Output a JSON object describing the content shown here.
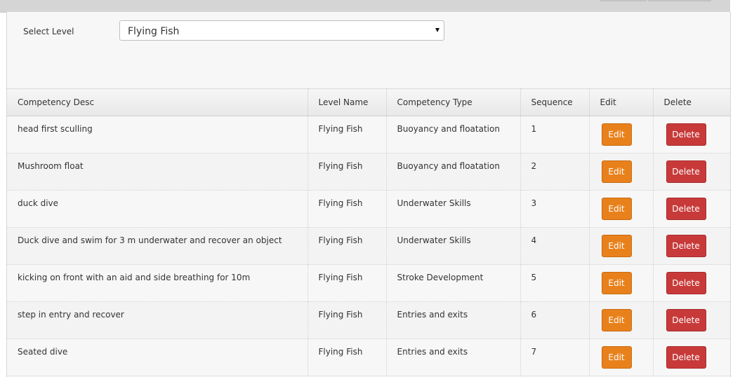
{
  "filter": {
    "label": "Select Level",
    "selected_value": "Flying Fish"
  },
  "table": {
    "headers": {
      "desc": "Competency Desc",
      "level": "Level Name",
      "type": "Competency Type",
      "sequence": "Sequence",
      "edit": "Edit",
      "delete": "Delete"
    },
    "rows": [
      {
        "desc": "head first sculling",
        "level": "Flying Fish",
        "type": "Buoyancy and floatation",
        "sequence": "1",
        "edit": "Edit",
        "delete": "Delete"
      },
      {
        "desc": "Mushroom float",
        "level": "Flying Fish",
        "type": "Buoyancy and floatation",
        "sequence": "2",
        "edit": "Edit",
        "delete": "Delete"
      },
      {
        "desc": "duck dive",
        "level": "Flying Fish",
        "type": "Underwater Skills",
        "sequence": "3",
        "edit": "Edit",
        "delete": "Delete"
      },
      {
        "desc": "Duck dive and swim for 3 m underwater and recover an object",
        "level": "Flying Fish",
        "type": "Underwater Skills",
        "sequence": "4",
        "edit": "Edit",
        "delete": "Delete"
      },
      {
        "desc": "kicking on front with an aid and side breathing for 10m",
        "level": "Flying Fish",
        "type": "Stroke Development",
        "sequence": "5",
        "edit": "Edit",
        "delete": "Delete"
      },
      {
        "desc": "step in entry and recover",
        "level": "Flying Fish",
        "type": "Entries and exits",
        "sequence": "6",
        "edit": "Edit",
        "delete": "Delete"
      },
      {
        "desc": "Seated dive",
        "level": "Flying Fish",
        "type": "Entries and exits",
        "sequence": "7",
        "edit": "Edit",
        "delete": "Delete"
      }
    ]
  },
  "colors": {
    "edit_button": "#e8811c",
    "delete_button": "#c83a3a"
  },
  "icons": {
    "select_arrow": "caret-down-icon"
  }
}
